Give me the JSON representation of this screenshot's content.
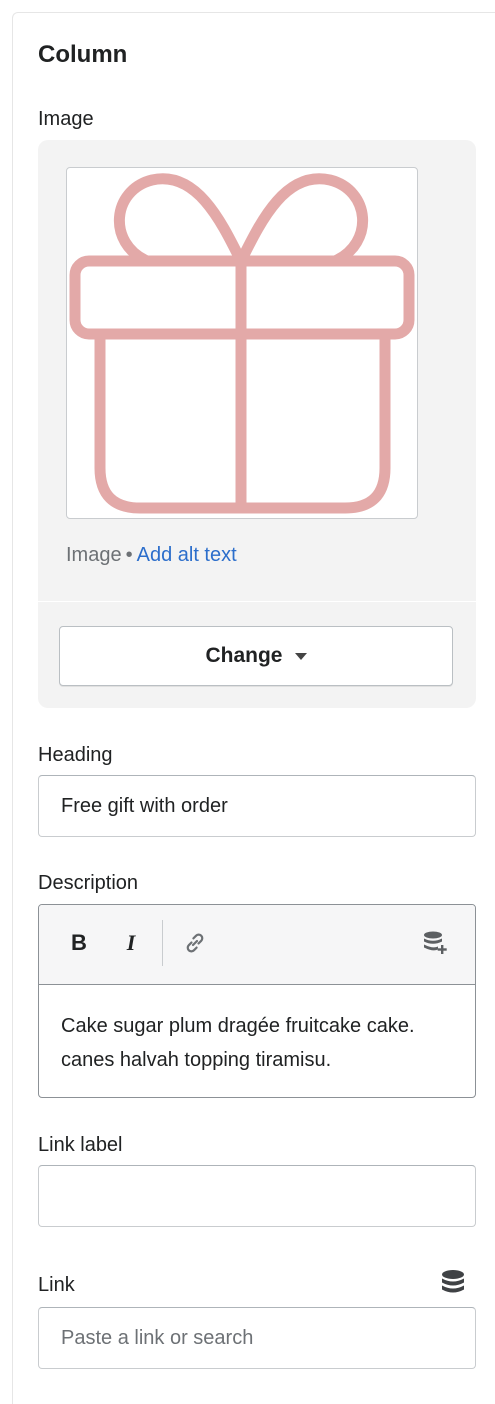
{
  "section": {
    "title": "Column"
  },
  "image": {
    "label": "Image",
    "meta_type": "Image",
    "meta_separator": "•",
    "alt_link": "Add alt text",
    "change_button": "Change",
    "icon": "gift-icon",
    "icon_color": "#e3a9a8"
  },
  "heading": {
    "label": "Heading",
    "value": "Free gift with order"
  },
  "description": {
    "label": "Description",
    "toolbar": {
      "bold": "B",
      "italic": "I",
      "link_icon": "link-icon",
      "source_icon": "database-plus-icon"
    },
    "text": "Cake sugar plum dragée fruitcake cake. canes halvah topping tiramisu."
  },
  "link_label": {
    "label": "Link label",
    "value": ""
  },
  "link": {
    "label": "Link",
    "placeholder": "Paste a link or search",
    "source_icon": "database-icon"
  },
  "colors": {
    "link": "#2c6ecb",
    "text": "#202223",
    "subdued": "#6d7175"
  }
}
